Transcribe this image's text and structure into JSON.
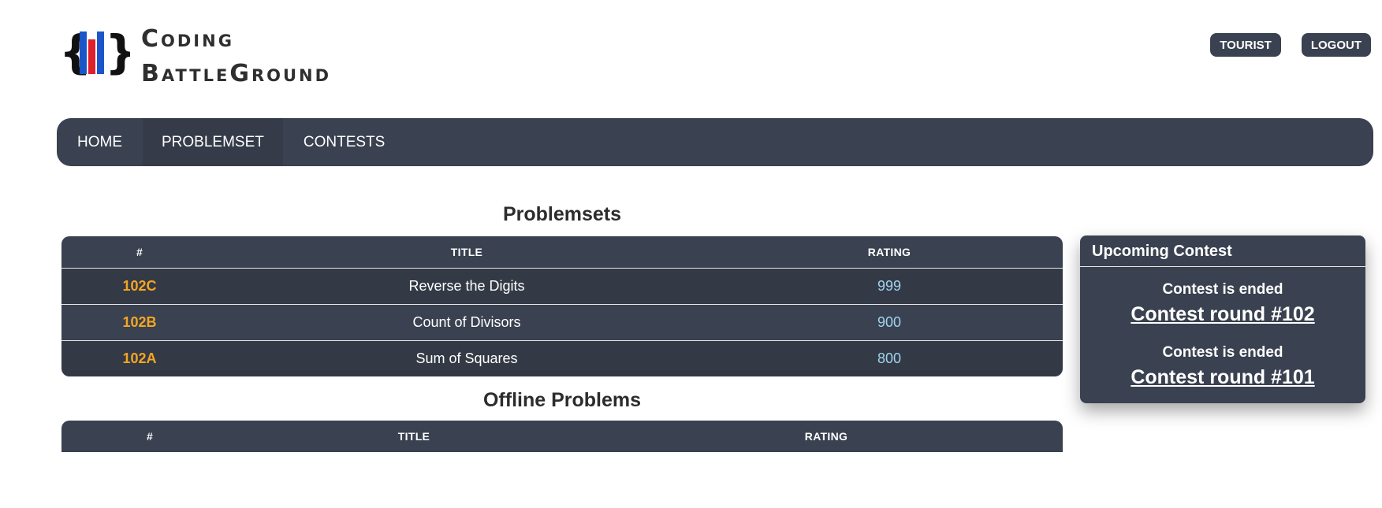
{
  "brand": {
    "line1": "Coding",
    "line2": "BattleGround",
    "colors": {
      "bar_blue": "#1a56c8",
      "bar_red": "#e0202a",
      "braces": "#111111"
    }
  },
  "header": {
    "user_label": "TOURIST",
    "logout_label": "LOGOUT"
  },
  "nav": {
    "items": [
      {
        "label": "HOME"
      },
      {
        "label": "PROBLEMSET"
      },
      {
        "label": "CONTESTS"
      }
    ]
  },
  "problemsets": {
    "title": "Problemsets",
    "columns": [
      "#",
      "TITLE",
      "RATING"
    ],
    "rows": [
      {
        "id": "102C",
        "title": "Reverse the Digits",
        "rating": "999"
      },
      {
        "id": "102B",
        "title": "Count of Divisors",
        "rating": "900"
      },
      {
        "id": "102A",
        "title": "Sum of Squares",
        "rating": "800"
      }
    ]
  },
  "offline": {
    "title": "Offline Problems",
    "columns": [
      "#",
      "TITLE",
      "RATING"
    ]
  },
  "sidebar": {
    "title": "Upcoming Contest",
    "contests": [
      {
        "status": "Contest is ended",
        "name": "Contest round #102"
      },
      {
        "status": "Contest is ended",
        "name": "Contest round #101"
      }
    ]
  },
  "colors": {
    "panel": "#3a4150",
    "id_orange": "#f5a623",
    "rating_blue": "#9fd3f0"
  }
}
